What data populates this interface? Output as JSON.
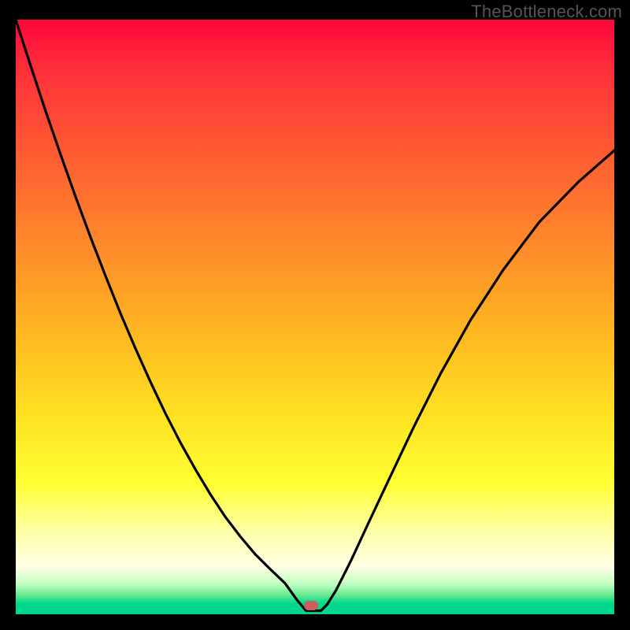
{
  "watermark": "TheBottleneck.com",
  "marker": {
    "x_fraction": 0.494,
    "y_fraction": 0.985
  },
  "chart_data": {
    "type": "line",
    "title": "",
    "xlabel": "",
    "ylabel": "",
    "xlim": [
      0,
      1
    ],
    "ylim": [
      0,
      1
    ],
    "grid": false,
    "series": [
      {
        "name": "bottleneck-curve",
        "x": [
          0.0,
          0.025,
          0.05,
          0.075,
          0.1,
          0.125,
          0.15,
          0.175,
          0.2,
          0.225,
          0.25,
          0.275,
          0.3,
          0.325,
          0.35,
          0.375,
          0.4,
          0.425,
          0.45,
          0.46,
          0.47,
          0.485,
          0.51,
          0.52,
          0.535,
          0.56,
          0.59,
          0.625,
          0.665,
          0.71,
          0.76,
          0.815,
          0.875,
          0.94,
          1.0
        ],
        "y": [
          1.0,
          0.922,
          0.846,
          0.773,
          0.702,
          0.634,
          0.569,
          0.506,
          0.447,
          0.391,
          0.338,
          0.289,
          0.244,
          0.202,
          0.164,
          0.131,
          0.101,
          0.076,
          0.052,
          0.038,
          0.024,
          0.006,
          0.006,
          0.016,
          0.04,
          0.09,
          0.155,
          0.23,
          0.315,
          0.405,
          0.495,
          0.58,
          0.66,
          0.727,
          0.78
        ]
      }
    ],
    "background_gradient": {
      "top": "#ff0a3a",
      "mid": "#ffe021",
      "bottom": "#00d68f"
    },
    "marker": {
      "x": 0.494,
      "y": 0.015,
      "color": "#cd5c5c"
    }
  }
}
